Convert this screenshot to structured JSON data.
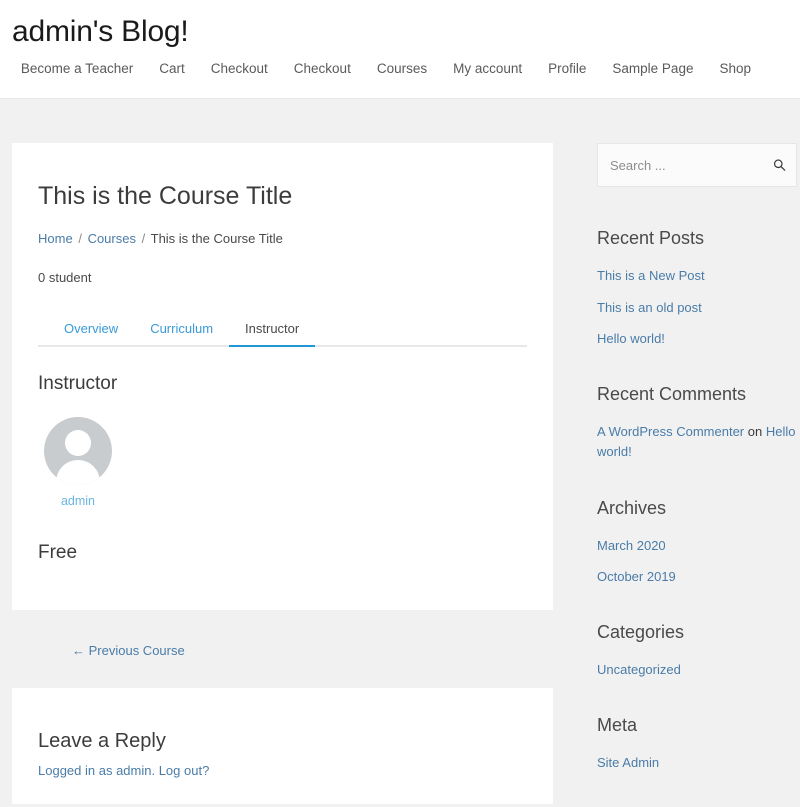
{
  "header": {
    "site_title": "admin's Blog!",
    "nav_items": [
      {
        "label": "Become a Teacher"
      },
      {
        "label": "Cart"
      },
      {
        "label": "Checkout"
      },
      {
        "label": "Checkout"
      },
      {
        "label": "Courses"
      },
      {
        "label": "My account"
      },
      {
        "label": "Profile"
      },
      {
        "label": "Sample Page"
      },
      {
        "label": "Shop"
      }
    ]
  },
  "course": {
    "title": "This is the Course Title",
    "breadcrumb": {
      "home": "Home",
      "courses": "Courses",
      "current": "This is the Course Title",
      "separator": "/"
    },
    "student_count": "0 student",
    "tabs": [
      {
        "label": "Overview",
        "active": false
      },
      {
        "label": "Curriculum",
        "active": false
      },
      {
        "label": "Instructor",
        "active": true
      }
    ],
    "instructor_heading": "Instructor",
    "instructor_name": "admin",
    "price": "Free",
    "previous_course": "← Previous Course"
  },
  "comments": {
    "title": "Leave a Reply",
    "logged_in_prefix": "Logged in as admin. ",
    "logout_label": "Log out?"
  },
  "sidebar": {
    "search": {
      "placeholder": "Search ...",
      "value": "",
      "icon": "search-icon"
    },
    "widgets": [
      {
        "title": "Recent Posts",
        "items": [
          {
            "label": "This is a New Post"
          },
          {
            "label": "This is an old post"
          },
          {
            "label": "Hello world!"
          }
        ]
      },
      {
        "title": "Recent Comments",
        "comment": {
          "author": "A WordPress Commenter",
          "on": " on ",
          "post": "Hello world!"
        }
      },
      {
        "title": "Archives",
        "items": [
          {
            "label": "March 2020"
          },
          {
            "label": "October 2019"
          }
        ]
      },
      {
        "title": "Categories",
        "items": [
          {
            "label": "Uncategorized"
          }
        ]
      },
      {
        "title": "Meta",
        "items": [
          {
            "label": "Site Admin"
          }
        ]
      }
    ]
  },
  "colors": {
    "link": "#4a7ca8",
    "tab_link": "#3a9ad9",
    "tab_active_underline": "#2196d6",
    "page_background": "#f1f1f1",
    "card_background": "#ffffff",
    "avatar_background": "#c9ccce"
  }
}
